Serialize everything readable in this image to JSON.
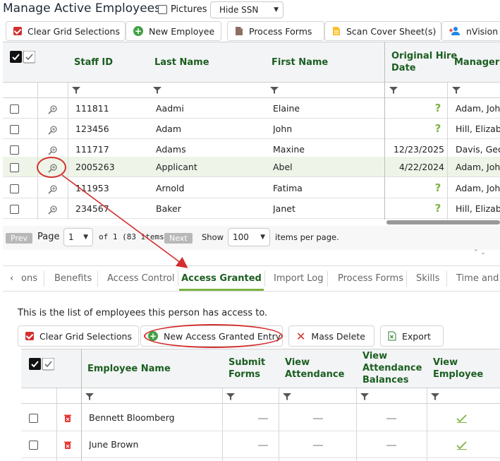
{
  "header": {
    "title": "Manage Active Employees",
    "pictures_label": "Pictures",
    "ssn_select": "Hide SSN"
  },
  "toolbar": {
    "clear_grid": "Clear Grid Selections",
    "new_employee": "New Employee",
    "process_forms": "Process Forms",
    "scan_cover": "Scan Cover Sheet(s)",
    "nvision": "nVision E"
  },
  "employee_grid": {
    "columns": [
      "Staff ID",
      "Last Name",
      "First Name",
      "Original Hire",
      "Date",
      "Manager /"
    ],
    "rows": [
      {
        "staff_id": "111811",
        "last": "Aadmi",
        "first": "Elaine",
        "hire": "?",
        "manager": "Adam, John"
      },
      {
        "staff_id": "123456",
        "last": "Adam",
        "first": "John",
        "hire": "?",
        "manager": "Hill, Elizabe"
      },
      {
        "staff_id": "111717",
        "last": "Adams",
        "first": "Maxine",
        "hire": "12/23/2025",
        "manager": "Davis, Geor"
      },
      {
        "staff_id": "2005263",
        "last": "Applicant",
        "first": "Abel",
        "hire": "4/22/2024",
        "manager": "Adam, John"
      },
      {
        "staff_id": "111953",
        "last": "Arnold",
        "first": "Fatima",
        "hire": "?",
        "manager": "Adam, John"
      },
      {
        "staff_id": "234567",
        "last": "Baker",
        "first": "Janet",
        "hire": "?",
        "manager": "Hill, Elizabe"
      }
    ]
  },
  "pager": {
    "prev": "Prev",
    "page_label": "Page",
    "page_value": "1",
    "of_text": "of 1 (83 items)",
    "next": "Next",
    "show_label": "Show",
    "per_page": "100",
    "items_per_page": "items per page."
  },
  "tabs": [
    "ons",
    "Benefits",
    "Access Control",
    "Access Granted",
    "Import Log",
    "Process Forms",
    "Skills",
    "Time and A"
  ],
  "tab_prev_glyph": "‹",
  "access": {
    "description": "This is the list of employees this person has access to.",
    "clear_grid": "Clear Grid Selections",
    "new_entry": "New Access Granted Entry",
    "mass_delete": "Mass Delete",
    "export": "Export",
    "columns": {
      "employee_name": "Employee Name",
      "submit_forms_1": "Submit",
      "submit_forms_2": "Forms",
      "view_attendance_1": "View",
      "view_attendance_2": "Attendance",
      "view_balances_1": "View",
      "view_balances_2": "Attendance",
      "view_balances_3": "Balances",
      "view_employee_1": "View",
      "view_employee_2": "Employee"
    },
    "rows": [
      {
        "name": "Bennett Bloomberg"
      },
      {
        "name": "June Brown"
      }
    ]
  },
  "colors": {
    "accent_green": "#1b5e20",
    "light_green": "#7cb342",
    "danger_red": "#d32f2f",
    "annotation_red": "#d32f2f"
  }
}
